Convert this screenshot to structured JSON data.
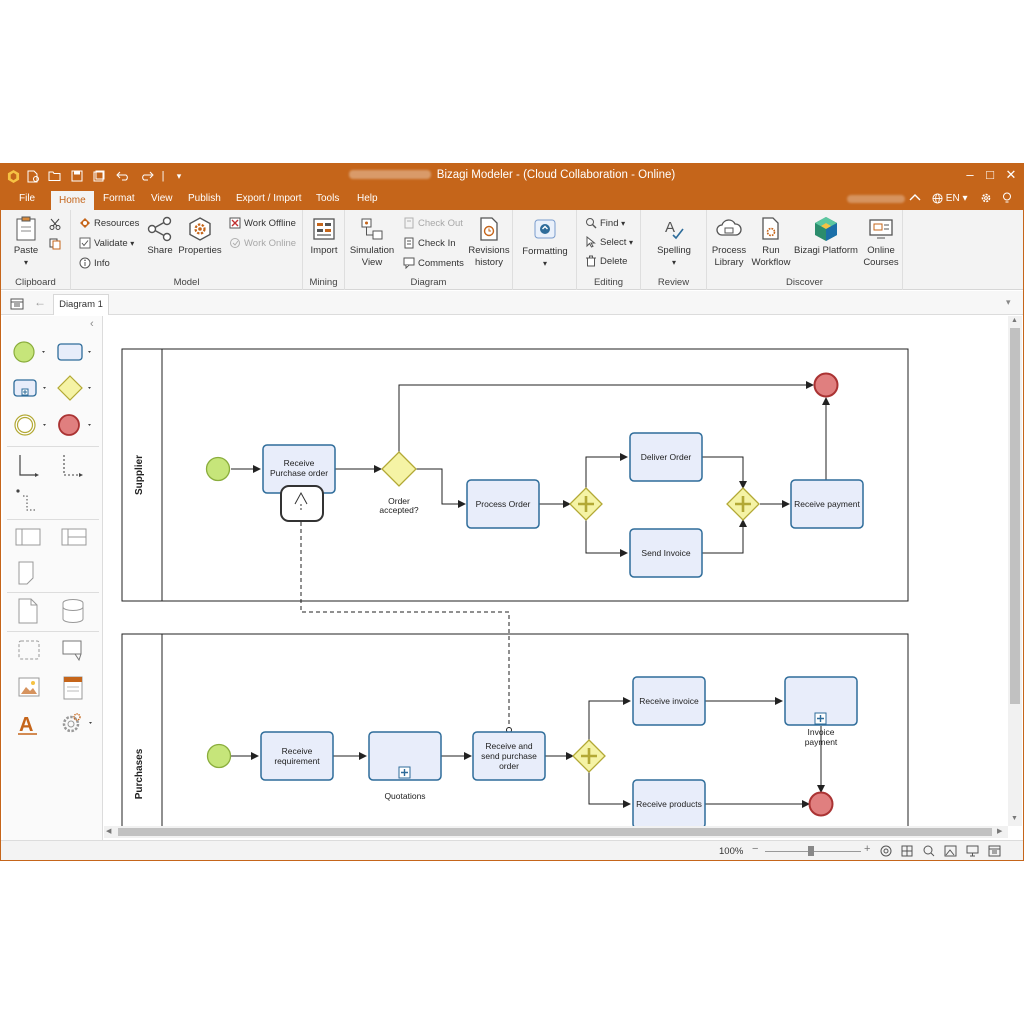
{
  "window": {
    "title": "Bizagi Modeler - (Cloud Collaboration - Online)",
    "minimize": "‒",
    "maximize": "□",
    "close": "✕"
  },
  "menu": {
    "items": [
      "File",
      "Home",
      "Format",
      "View",
      "Publish",
      "Export / Import",
      "Tools",
      "Help"
    ],
    "active": "Home",
    "language": "EN"
  },
  "ribbon": {
    "clipboard": {
      "group": "Clipboard",
      "paste": "Paste"
    },
    "model": {
      "group": "Model",
      "resources": "Resources",
      "validate": "Validate",
      "info": "Info",
      "share": "Share",
      "properties": "Properties",
      "work_offline": "Work Offline",
      "work_online": "Work Online"
    },
    "mining": {
      "group": "Mining",
      "import": "Import"
    },
    "diagram": {
      "group": "Diagram",
      "simulation": "Simulation",
      "simulation2": "View",
      "check_out": "Check Out",
      "check_in": "Check In",
      "comments": "Comments",
      "revisions": "Revisions",
      "revisions2": "history"
    },
    "formatting": {
      "label": "Formatting"
    },
    "editing": {
      "group": "Editing",
      "find": "Find",
      "select": "Select",
      "delete": "Delete"
    },
    "review": {
      "group": "Review",
      "spelling": "Spelling"
    },
    "discover": {
      "group": "Discover",
      "process_library": "Process",
      "process_library2": "Library",
      "run_workflow": "Run",
      "run_workflow2": "Workflow",
      "bizagi_platform": "Bizagi Platform",
      "online_courses": "Online",
      "online_courses2": "Courses"
    }
  },
  "tabs": {
    "diagram_tab": "Diagram 1"
  },
  "lanes": {
    "supplier": "Supplier",
    "purchases": "Purchases"
  },
  "tasks": {
    "receive_po": [
      "Receive",
      "Purchase order"
    ],
    "process_order": [
      "Process Order"
    ],
    "deliver_order": [
      "Deliver Order"
    ],
    "send_invoice": [
      "Send Invoice"
    ],
    "receive_payment": [
      "Receive payment"
    ],
    "receive_requirement": [
      "Receive",
      "requirement"
    ],
    "receive_send_po": [
      "Receive and",
      "send purchase",
      "order"
    ],
    "receive_invoice": [
      "Receive invoice"
    ],
    "receive_products": [
      "Receive products"
    ]
  },
  "labels": {
    "order_accepted": [
      "Order",
      "accepted?"
    ],
    "quotations": [
      "Quotations"
    ],
    "invoice_payment": [
      "Invoice",
      "payment"
    ]
  },
  "status": {
    "zoom": "100%"
  },
  "colors": {
    "brand": "#c5651a",
    "task_fill": "#e8edfa",
    "task_stroke": "#2e6c9a",
    "start_fill": "#c6e57a",
    "end_fill": "#e07f7f",
    "gateway_fill": "#f5f3a5"
  }
}
